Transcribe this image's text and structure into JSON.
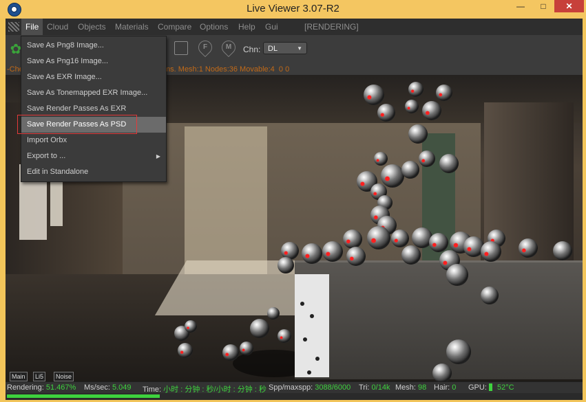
{
  "window": {
    "title": "Live Viewer 3.07-R2",
    "min_glyph": "—",
    "max_glyph": "□",
    "close_glyph": "✕"
  },
  "menubar": {
    "items": [
      "File",
      "Cloud",
      "Objects",
      "Materials",
      "Compare",
      "Options",
      "Help",
      "Gui"
    ],
    "status": "[RENDERING]"
  },
  "toolbar": {
    "chn_label": "Chn:",
    "chn_value": "DL",
    "icon_f": "F",
    "icon_m": "M"
  },
  "stats_line": "-Che                                                         GI]:36ms. Mesh:1 Nodes:36 Movable:4  0 0",
  "file_menu": {
    "items": [
      "Save As Png8 Image...",
      "Save As Png16 Image...",
      "Save As EXR Image...",
      "Save As Tonemapped EXR Image...",
      "Save Render Passes As EXR",
      "Save Render Passes As PSD",
      "Import Orbx",
      "Export to ...",
      "Edit in Standalone"
    ],
    "hovered_index": 5
  },
  "bottom_tabs": [
    "Main",
    "Li5",
    "Noise"
  ],
  "status": {
    "rendering_label": "Rendering:",
    "rendering_value": "51.467%",
    "ms_label": "Ms/sec:",
    "ms_value": "5.049",
    "time_label": "Time:",
    "time_value": "小时 : 分钟 : 秒/小时 : 分钟 : 秒",
    "spp_label": "Spp/maxspp:",
    "spp_value": "3088/6000",
    "tri_label": "Tri:",
    "tri_value": "0/14k",
    "mesh_label": "Mesh:",
    "mesh_value": "98",
    "hair_label": "Hair:",
    "hair_value": "0",
    "gpu_label": "GPU:",
    "gpu_temp": "52°C"
  },
  "progress_fraction": 0.515,
  "colors": {
    "accent_green": "#3ed23e",
    "highlight_red": "#e23a3a",
    "stats_orange": "#c26a18"
  }
}
